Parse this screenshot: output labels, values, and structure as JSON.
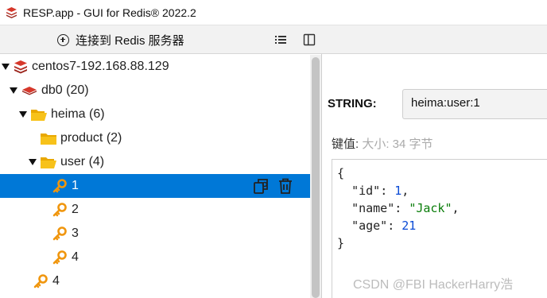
{
  "window": {
    "title": "RESP.app - GUI for Redis® 2022.2"
  },
  "toolbar": {
    "connect_label": "连接到 Redis 服务器"
  },
  "tree": {
    "server": "centos7-192.168.88.129",
    "db": "db0 (20)",
    "folder_heima": "heima (6)",
    "folder_product": "product (2)",
    "folder_user": "user (4)",
    "keys": [
      "1",
      "2",
      "3",
      "4"
    ],
    "root_key": "4"
  },
  "detail": {
    "type": "STRING:",
    "key_name": "heima:user:1",
    "value_label": "键值:",
    "size_text": "大小: 34 字节"
  },
  "value": {
    "open_brace": "{",
    "close_brace": "}",
    "fields": [
      {
        "key": "\"id\"",
        "val": "1",
        "kind": "num",
        "sep": ","
      },
      {
        "key": "\"name\"",
        "val": "\"Jack\"",
        "kind": "str",
        "sep": ","
      },
      {
        "key": "\"age\"",
        "val": "21",
        "kind": "num",
        "sep": ""
      }
    ]
  },
  "watermark": "CSDN @FBI HackerHarry浩",
  "colors": {
    "selection": "#0078d7",
    "folder": "#f5b800",
    "key": "#f0960e",
    "redis": "#d6382b"
  }
}
